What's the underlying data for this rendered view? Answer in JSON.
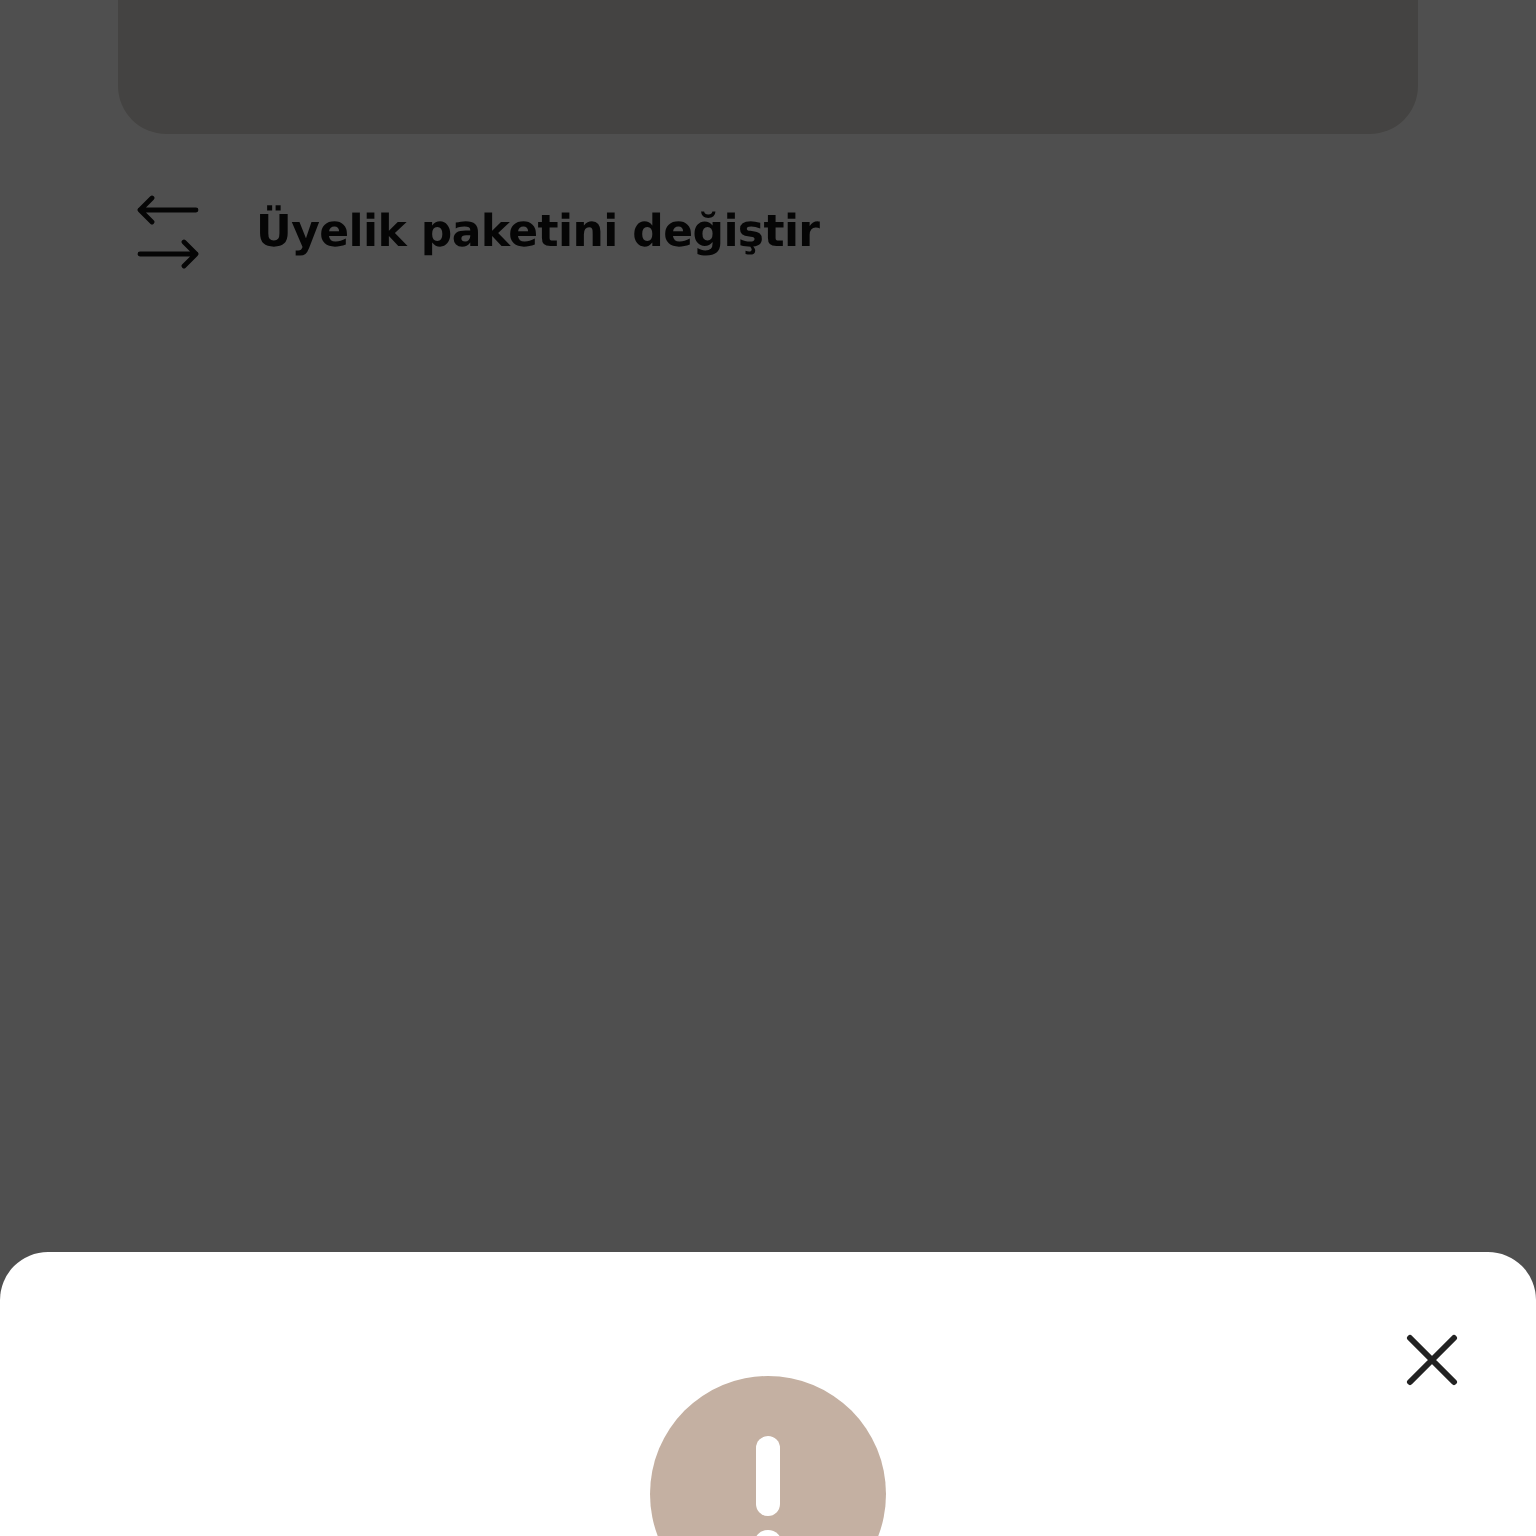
{
  "menu_items": [
    {
      "label": "Üyelik paketini değiştir"
    }
  ],
  "dialog": {
    "open": true
  }
}
